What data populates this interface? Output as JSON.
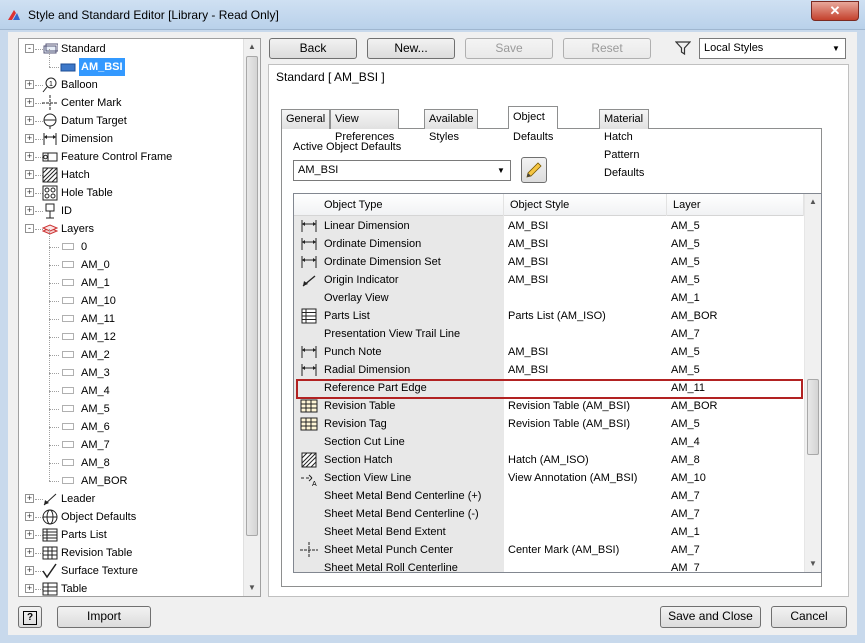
{
  "window": {
    "title": "Style and Standard Editor [Library - Read Only]",
    "close_label": "✕"
  },
  "toolbar": {
    "back": "Back",
    "new": "New...",
    "save": "Save",
    "reset": "Reset",
    "filter_value": "Local Styles"
  },
  "standard_label": "Standard [ AM_BSI ]",
  "tree": {
    "standard": "Standard",
    "am_bsi": "AM_BSI",
    "items": [
      "Balloon",
      "Center Mark",
      "Datum Target",
      "Dimension",
      "Feature Control Frame",
      "Hatch",
      "Hole Table",
      "ID",
      "Layers"
    ],
    "layers": [
      "0",
      "AM_0",
      "AM_1",
      "AM_10",
      "AM_11",
      "AM_12",
      "AM_2",
      "AM_3",
      "AM_4",
      "AM_5",
      "AM_6",
      "AM_7",
      "AM_8",
      "AM_BOR"
    ],
    "after": [
      "Leader",
      "Object Defaults",
      "Parts List",
      "Revision Table",
      "Surface Texture",
      "Table"
    ]
  },
  "tabs": [
    "General",
    "View Preferences",
    "Available Styles",
    "Object Defaults",
    "Material Hatch Pattern Defaults"
  ],
  "active_defaults": {
    "label": "Active Object Defaults",
    "value": "AM_BSI"
  },
  "grid": {
    "headers": [
      "Object Type",
      "Object Style",
      "Layer"
    ],
    "rows": [
      {
        "icon": "linear-dimension-icon",
        "type": "Linear Dimension",
        "style": "AM_BSI",
        "layer": "AM_5"
      },
      {
        "icon": "ordinate-dimension-icon",
        "type": "Ordinate Dimension",
        "style": "AM_BSI",
        "layer": "AM_5"
      },
      {
        "icon": "ordinate-dimension-set-icon",
        "type": "Ordinate Dimension Set",
        "style": "AM_BSI",
        "layer": "AM_5"
      },
      {
        "icon": "origin-indicator-icon",
        "type": "Origin Indicator",
        "style": "AM_BSI",
        "layer": "AM_5"
      },
      {
        "icon": "",
        "type": "Overlay View",
        "style": "",
        "layer": "AM_1"
      },
      {
        "icon": "parts-list-icon",
        "type": "Parts List",
        "style": "Parts List (AM_ISO)",
        "layer": "AM_BOR"
      },
      {
        "icon": "",
        "type": "Presentation View Trail Line",
        "style": "",
        "layer": "AM_7"
      },
      {
        "icon": "punch-note-icon",
        "type": "Punch Note",
        "style": "AM_BSI",
        "layer": "AM_5"
      },
      {
        "icon": "radial-dimension-icon",
        "type": "Radial Dimension",
        "style": "AM_BSI",
        "layer": "AM_5"
      },
      {
        "icon": "",
        "type": "Reference Part Edge",
        "style": "",
        "layer": "AM_11"
      },
      {
        "icon": "revision-table-icon",
        "type": "Revision Table",
        "style": "Revision Table (AM_BSI)",
        "layer": "AM_BOR"
      },
      {
        "icon": "revision-tag-icon",
        "type": "Revision Tag",
        "style": "Revision Table (AM_BSI)",
        "layer": "AM_5"
      },
      {
        "icon": "",
        "type": "Section Cut Line",
        "style": "",
        "layer": "AM_4"
      },
      {
        "icon": "section-hatch-icon",
        "type": "Section Hatch",
        "style": "Hatch (AM_ISO)",
        "layer": "AM_8"
      },
      {
        "icon": "section-view-line-icon",
        "type": "Section View Line",
        "style": "View Annotation (AM_BSI)",
        "layer": "AM_10"
      },
      {
        "icon": "",
        "type": "Sheet Metal Bend Centerline (+)",
        "style": "",
        "layer": "AM_7"
      },
      {
        "icon": "",
        "type": "Sheet Metal Bend Centerline (-)",
        "style": "",
        "layer": "AM_7"
      },
      {
        "icon": "",
        "type": "Sheet Metal Bend Extent",
        "style": "",
        "layer": "AM_1"
      },
      {
        "icon": "punch-center-icon",
        "type": "Sheet Metal Punch Center",
        "style": "Center Mark (AM_BSI)",
        "layer": "AM_7"
      },
      {
        "icon": "",
        "type": "Sheet Metal Roll Centerline",
        "style": "",
        "layer": "AM_7"
      }
    ]
  },
  "footer": {
    "help": "?",
    "import": "Import",
    "save_close": "Save and Close",
    "cancel": "Cancel"
  }
}
